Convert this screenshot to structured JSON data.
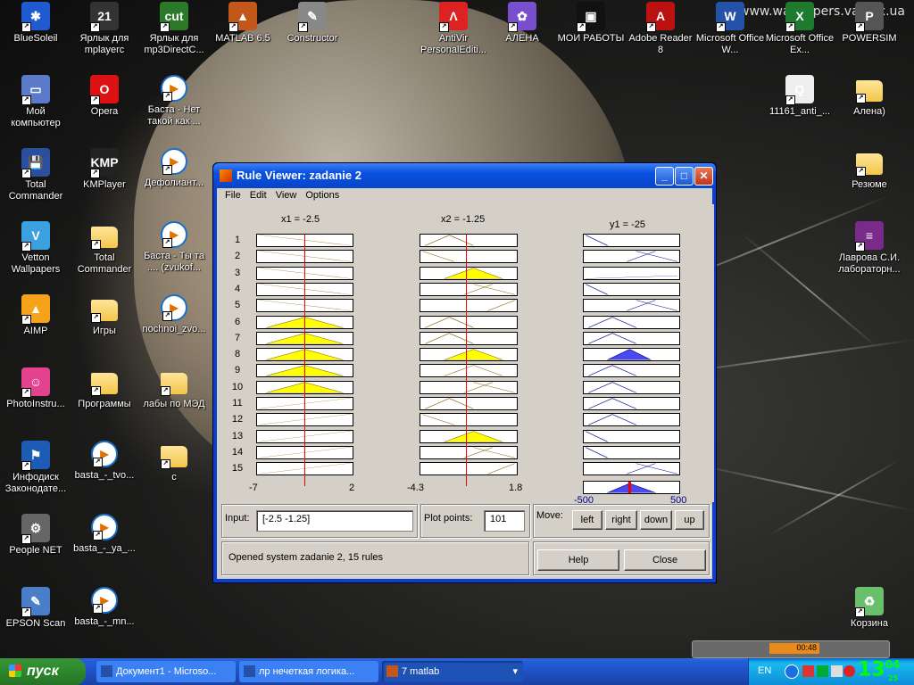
{
  "watermark": "www.wallpapers.vastex.ua",
  "desktop_icons": [
    {
      "label": "BlueSoleil",
      "color": "#1e5bd1",
      "glyph": "✱"
    },
    {
      "label": "Ярлык для mplayerc",
      "color": "#333",
      "glyph": "21"
    },
    {
      "label": "Ярлык для mp3DirectC...",
      "color": "#2a7a2a",
      "glyph": "cut"
    },
    {
      "label": "MATLAB 6.5",
      "color": "#c2571a",
      "glyph": "▲"
    },
    {
      "label": "Constructor",
      "color": "#888",
      "glyph": "✎"
    },
    {
      "label": "AntiVir PersonalEditi...",
      "color": "#d22",
      "glyph": "Λ"
    },
    {
      "label": "АЛЕНА",
      "color": "#7a4fcf",
      "glyph": "✿"
    },
    {
      "label": "МОИ РАБОТЫ",
      "color": "#111",
      "glyph": "▣"
    },
    {
      "label": "Adobe Reader 8",
      "color": "#b11",
      "glyph": "A"
    },
    {
      "label": "Microsoft Office W...",
      "color": "#2452a8",
      "glyph": "W"
    },
    {
      "label": "Microsoft Office Ex...",
      "color": "#1e7a2e",
      "glyph": "X"
    },
    {
      "label": "POWERSIM",
      "color": "#555",
      "glyph": "P"
    },
    {
      "label": "Мой компьютер",
      "color": "#5b7ac9",
      "glyph": "▭"
    },
    {
      "label": "Opera",
      "color": "#d11",
      "glyph": "O"
    },
    {
      "label": "Баста - Нет такой как ...",
      "color": "media",
      "glyph": "▶"
    },
    {
      "label": "11161_anti_...",
      "color": "#eee",
      "glyph": "Q"
    },
    {
      "label": "Алена)",
      "color": "folder",
      "glyph": ""
    },
    {
      "label": "Total Commander",
      "color": "#2a4f9e",
      "glyph": "💾"
    },
    {
      "label": "KMPlayer",
      "color": "#222",
      "glyph": "KMP"
    },
    {
      "label": "Дефолиант...",
      "color": "media",
      "glyph": "▶"
    },
    {
      "label": "Резюме",
      "color": "folder",
      "glyph": ""
    },
    {
      "label": "Vetton Wallpapers",
      "color": "#3aa0e0",
      "glyph": "V"
    },
    {
      "label": "Total Commander",
      "color": "folder",
      "glyph": ""
    },
    {
      "label": "Баста - Ты та .... (zvukof...",
      "color": "media",
      "glyph": "▶"
    },
    {
      "label": "Лаврова С.И. лабораторн...",
      "color": "#7a2a8a",
      "glyph": "≡"
    },
    {
      "label": "AIMP",
      "color": "#f6a21a",
      "glyph": "▲"
    },
    {
      "label": "Игры",
      "color": "folder",
      "glyph": ""
    },
    {
      "label": "nochnoi_zvo...",
      "color": "media",
      "glyph": "▶"
    },
    {
      "label": "PhotoInstru...",
      "color": "#e4418e",
      "glyph": "☺"
    },
    {
      "label": "Программы",
      "color": "folder",
      "glyph": ""
    },
    {
      "label": "лабы по МЭД",
      "color": "folder",
      "glyph": ""
    },
    {
      "label": "Инфодиск Законодате...",
      "color": "#1d5cb5",
      "glyph": "⚑"
    },
    {
      "label": "basta_-_tvo...",
      "color": "media",
      "glyph": "▶"
    },
    {
      "label": "с",
      "color": "folder",
      "glyph": ""
    },
    {
      "label": "People NET",
      "color": "#666",
      "glyph": "⚙"
    },
    {
      "label": "basta_-_ya_...",
      "color": "media",
      "glyph": "▶"
    },
    {
      "label": "EPSON Scan",
      "color": "#4a7ec9",
      "glyph": "✎"
    },
    {
      "label": "basta_-_mn...",
      "color": "media",
      "glyph": "▶"
    },
    {
      "label": "Корзина",
      "color": "#6ac06a",
      "glyph": "♻"
    }
  ],
  "window": {
    "title": "Rule Viewer: zadanie 2",
    "menu": [
      "File",
      "Edit",
      "View",
      "Options"
    ],
    "headers": {
      "x1": "x1 = -2.5",
      "x2": "x2 = -1.25",
      "y1": "y1 = -25"
    },
    "rows": [
      "1",
      "2",
      "3",
      "4",
      "5",
      "6",
      "7",
      "8",
      "9",
      "10",
      "11",
      "12",
      "13",
      "14",
      "15"
    ],
    "x1_axis": {
      "min": "-7",
      "max": "2"
    },
    "x2_axis": {
      "min": "-4.3",
      "max": "1.8"
    },
    "y1_axis": {
      "min": "-500",
      "max": "500"
    },
    "input_label": "Input:",
    "input_value": "[-2.5 -1.25]",
    "plot_points_label": "Plot points:",
    "plot_points_value": "101",
    "move_label": "Move:",
    "move_buttons": [
      "left",
      "right",
      "down",
      "up"
    ],
    "status": "Opened system zadanie 2, 15 rules",
    "help_label": "Help",
    "close_label": "Close"
  },
  "taskbar": {
    "start_label": "пуск",
    "tasks": [
      {
        "label": "Документ1 - Microso...",
        "color": "#2452a8"
      },
      {
        "label": "лр нечеткая логика...",
        "color": "#2452a8"
      },
      {
        "label": "7 matlab",
        "color": "#c2571a"
      }
    ],
    "lang": "EN",
    "clock_hours": "13",
    "clock_minutes": "04",
    "clock_seconds": "25",
    "player_time": "00:48"
  }
}
